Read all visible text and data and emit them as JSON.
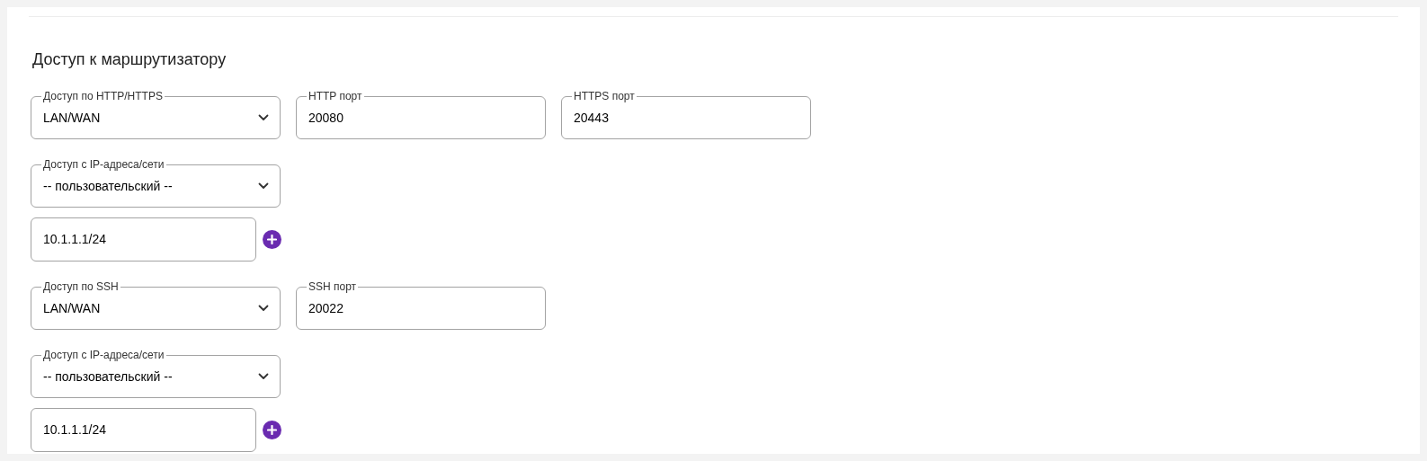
{
  "heading": "Доступ к маршрутизатору",
  "rows": [
    {
      "fields": [
        {
          "kind": "select",
          "label": "Доступ по HTTP/HTTPS",
          "value": "LAN/WAN"
        },
        {
          "kind": "text",
          "label": "HTTP порт",
          "value": "20080"
        },
        {
          "kind": "text",
          "label": "HTTPS порт",
          "value": "20443"
        }
      ]
    },
    {
      "fields": [
        {
          "kind": "select",
          "label": "Доступ с IP-адреса/сети",
          "value": "-- пользовательский --"
        }
      ]
    },
    {
      "fields": [
        {
          "kind": "address",
          "value": "10.1.1.1/24"
        }
      ]
    },
    {
      "fields": [
        {
          "kind": "select",
          "label": "Доступ по SSH",
          "value": "LAN/WAN"
        },
        {
          "kind": "text",
          "label": "SSH порт",
          "value": "20022"
        }
      ]
    },
    {
      "fields": [
        {
          "kind": "select",
          "label": "Доступ с IP-адреса/сети",
          "value": "-- пользовательский --"
        }
      ]
    },
    {
      "fields": [
        {
          "kind": "address",
          "value": "10.1.1.1/24"
        }
      ]
    }
  ]
}
